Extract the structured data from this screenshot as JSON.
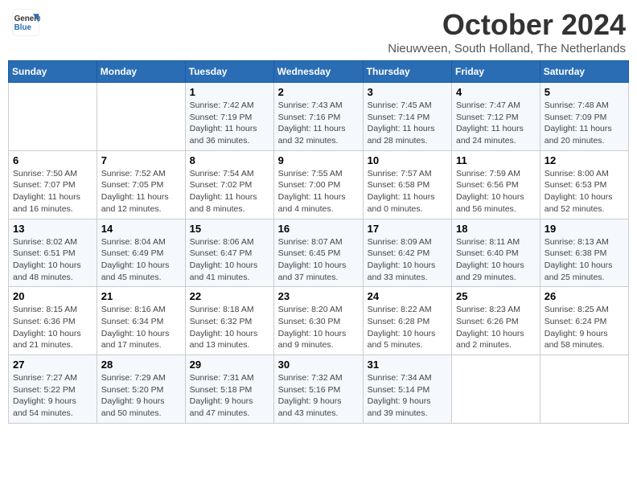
{
  "header": {
    "logo_line1": "General",
    "logo_line2": "Blue",
    "month_title": "October 2024",
    "location": "Nieuwveen, South Holland, The Netherlands"
  },
  "days_of_week": [
    "Sunday",
    "Monday",
    "Tuesday",
    "Wednesday",
    "Thursday",
    "Friday",
    "Saturday"
  ],
  "weeks": [
    [
      {
        "day": "",
        "info": ""
      },
      {
        "day": "",
        "info": ""
      },
      {
        "day": "1",
        "info": "Sunrise: 7:42 AM\nSunset: 7:19 PM\nDaylight: 11 hours\nand 36 minutes."
      },
      {
        "day": "2",
        "info": "Sunrise: 7:43 AM\nSunset: 7:16 PM\nDaylight: 11 hours\nand 32 minutes."
      },
      {
        "day": "3",
        "info": "Sunrise: 7:45 AM\nSunset: 7:14 PM\nDaylight: 11 hours\nand 28 minutes."
      },
      {
        "day": "4",
        "info": "Sunrise: 7:47 AM\nSunset: 7:12 PM\nDaylight: 11 hours\nand 24 minutes."
      },
      {
        "day": "5",
        "info": "Sunrise: 7:48 AM\nSunset: 7:09 PM\nDaylight: 11 hours\nand 20 minutes."
      }
    ],
    [
      {
        "day": "6",
        "info": "Sunrise: 7:50 AM\nSunset: 7:07 PM\nDaylight: 11 hours\nand 16 minutes."
      },
      {
        "day": "7",
        "info": "Sunrise: 7:52 AM\nSunset: 7:05 PM\nDaylight: 11 hours\nand 12 minutes."
      },
      {
        "day": "8",
        "info": "Sunrise: 7:54 AM\nSunset: 7:02 PM\nDaylight: 11 hours\nand 8 minutes."
      },
      {
        "day": "9",
        "info": "Sunrise: 7:55 AM\nSunset: 7:00 PM\nDaylight: 11 hours\nand 4 minutes."
      },
      {
        "day": "10",
        "info": "Sunrise: 7:57 AM\nSunset: 6:58 PM\nDaylight: 11 hours\nand 0 minutes."
      },
      {
        "day": "11",
        "info": "Sunrise: 7:59 AM\nSunset: 6:56 PM\nDaylight: 10 hours\nand 56 minutes."
      },
      {
        "day": "12",
        "info": "Sunrise: 8:00 AM\nSunset: 6:53 PM\nDaylight: 10 hours\nand 52 minutes."
      }
    ],
    [
      {
        "day": "13",
        "info": "Sunrise: 8:02 AM\nSunset: 6:51 PM\nDaylight: 10 hours\nand 48 minutes."
      },
      {
        "day": "14",
        "info": "Sunrise: 8:04 AM\nSunset: 6:49 PM\nDaylight: 10 hours\nand 45 minutes."
      },
      {
        "day": "15",
        "info": "Sunrise: 8:06 AM\nSunset: 6:47 PM\nDaylight: 10 hours\nand 41 minutes."
      },
      {
        "day": "16",
        "info": "Sunrise: 8:07 AM\nSunset: 6:45 PM\nDaylight: 10 hours\nand 37 minutes."
      },
      {
        "day": "17",
        "info": "Sunrise: 8:09 AM\nSunset: 6:42 PM\nDaylight: 10 hours\nand 33 minutes."
      },
      {
        "day": "18",
        "info": "Sunrise: 8:11 AM\nSunset: 6:40 PM\nDaylight: 10 hours\nand 29 minutes."
      },
      {
        "day": "19",
        "info": "Sunrise: 8:13 AM\nSunset: 6:38 PM\nDaylight: 10 hours\nand 25 minutes."
      }
    ],
    [
      {
        "day": "20",
        "info": "Sunrise: 8:15 AM\nSunset: 6:36 PM\nDaylight: 10 hours\nand 21 minutes."
      },
      {
        "day": "21",
        "info": "Sunrise: 8:16 AM\nSunset: 6:34 PM\nDaylight: 10 hours\nand 17 minutes."
      },
      {
        "day": "22",
        "info": "Sunrise: 8:18 AM\nSunset: 6:32 PM\nDaylight: 10 hours\nand 13 minutes."
      },
      {
        "day": "23",
        "info": "Sunrise: 8:20 AM\nSunset: 6:30 PM\nDaylight: 10 hours\nand 9 minutes."
      },
      {
        "day": "24",
        "info": "Sunrise: 8:22 AM\nSunset: 6:28 PM\nDaylight: 10 hours\nand 5 minutes."
      },
      {
        "day": "25",
        "info": "Sunrise: 8:23 AM\nSunset: 6:26 PM\nDaylight: 10 hours\nand 2 minutes."
      },
      {
        "day": "26",
        "info": "Sunrise: 8:25 AM\nSunset: 6:24 PM\nDaylight: 9 hours\nand 58 minutes."
      }
    ],
    [
      {
        "day": "27",
        "info": "Sunrise: 7:27 AM\nSunset: 5:22 PM\nDaylight: 9 hours\nand 54 minutes."
      },
      {
        "day": "28",
        "info": "Sunrise: 7:29 AM\nSunset: 5:20 PM\nDaylight: 9 hours\nand 50 minutes."
      },
      {
        "day": "29",
        "info": "Sunrise: 7:31 AM\nSunset: 5:18 PM\nDaylight: 9 hours\nand 47 minutes."
      },
      {
        "day": "30",
        "info": "Sunrise: 7:32 AM\nSunset: 5:16 PM\nDaylight: 9 hours\nand 43 minutes."
      },
      {
        "day": "31",
        "info": "Sunrise: 7:34 AM\nSunset: 5:14 PM\nDaylight: 9 hours\nand 39 minutes."
      },
      {
        "day": "",
        "info": ""
      },
      {
        "day": "",
        "info": ""
      }
    ]
  ]
}
